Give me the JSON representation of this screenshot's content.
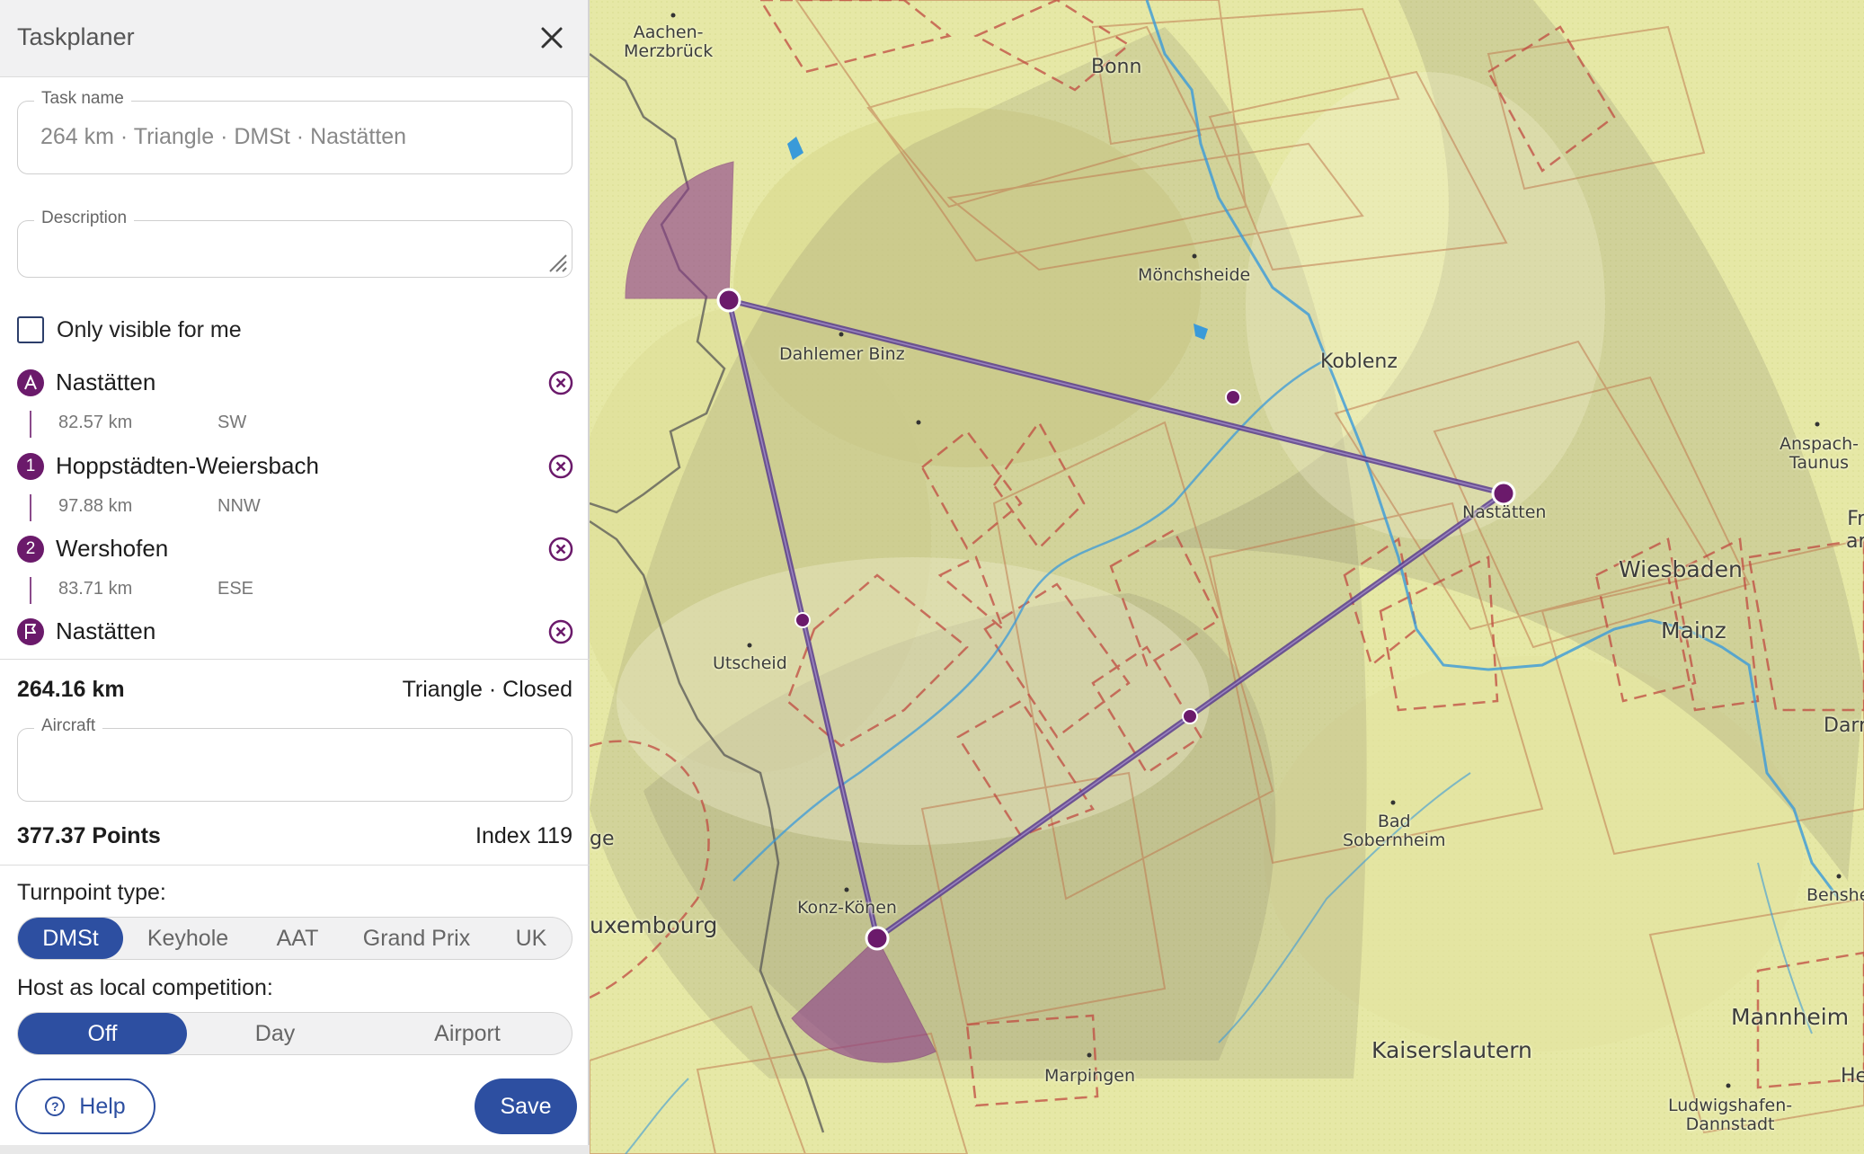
{
  "panel": {
    "title": "Taskplaner",
    "task_name": {
      "label": "Task name",
      "value": "264 km · Triangle · DMSt · Nastätten"
    },
    "description": {
      "label": "Description",
      "value": ""
    },
    "only_visible": {
      "label": "Only visible for me",
      "checked": false
    },
    "turnpoints": [
      {
        "badge": "A",
        "badge_type": "start",
        "name": "Nastätten"
      },
      {
        "badge": "1",
        "badge_type": "number",
        "name": "Hoppstädten-Weiersbach"
      },
      {
        "badge": "2",
        "badge_type": "number",
        "name": "Wershofen"
      },
      {
        "badge": "",
        "badge_type": "flag",
        "name": "Nastätten"
      }
    ],
    "legs": [
      {
        "distance": "82.57 km",
        "direction": "SW"
      },
      {
        "distance": "97.88 km",
        "direction": "NNW"
      },
      {
        "distance": "83.71 km",
        "direction": "ESE"
      }
    ],
    "total_distance": "264.16 km",
    "task_type": "Triangle · Closed",
    "aircraft": {
      "label": "Aircraft",
      "value": ""
    },
    "points": "377.37 Points",
    "index": "Index 119",
    "turnpoint_type": {
      "label": "Turnpoint type:",
      "options": [
        "DMSt",
        "Keyhole",
        "AAT",
        "Grand Prix",
        "UK"
      ],
      "selected": "DMSt"
    },
    "competition": {
      "label": "Host as local competition:",
      "options": [
        "Off",
        "Day",
        "Airport"
      ],
      "selected": "Off"
    },
    "help_label": "Help",
    "save_label": "Save"
  },
  "map": {
    "places": [
      {
        "name": "Aachen-\nMerzbrück"
      },
      {
        "name": "Bonn"
      },
      {
        "name": "Mönchsheide"
      },
      {
        "name": "Dahlemer Binz"
      },
      {
        "name": "Koblenz"
      },
      {
        "name": "Anspach-\nTaunus"
      },
      {
        "name": "Nastätten"
      },
      {
        "name": "Wiesbaden"
      },
      {
        "name": "Mainz"
      },
      {
        "name": "Utscheid"
      },
      {
        "name": "Bad\nSobernheim"
      },
      {
        "name": "Konz-Könen"
      },
      {
        "name": "uxembourg"
      },
      {
        "name": "ge"
      },
      {
        "name": "Marpingen"
      },
      {
        "name": "Kaiserslautern"
      },
      {
        "name": "Mannheim"
      },
      {
        "name": "Ludwigshafen-\nDannstadt"
      },
      {
        "name": "Benshe"
      },
      {
        "name": "Darr"
      },
      {
        "name": "Fr\nar"
      },
      {
        "name": "He"
      }
    ],
    "colors": {
      "task_line": "#5a3d8f",
      "turnpoint": "#6b1a6b",
      "sector": "#8b3a8b",
      "airspace": "#c05050",
      "river": "#3a9ad9",
      "terrain": "#e6e8a6"
    }
  }
}
